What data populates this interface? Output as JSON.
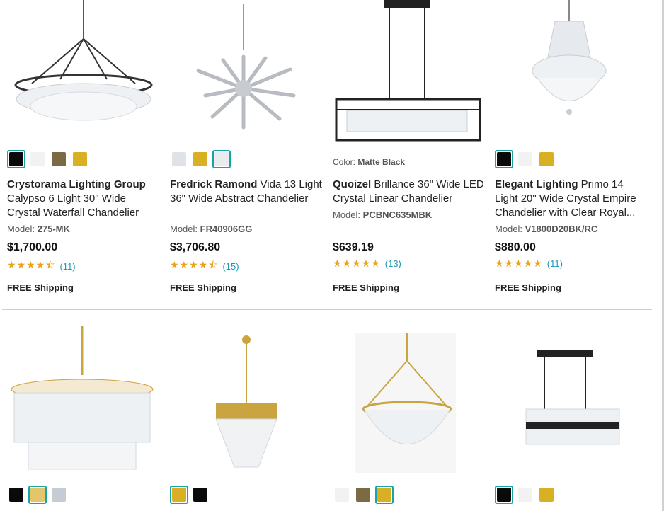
{
  "products_row1": [
    {
      "brand": "Crystorama Lighting Group",
      "name": " Calypso 6 Light 30\" Wide Crystal Waterfall Chandelier",
      "model_label": "Model:",
      "model": "275-MK",
      "price": "$1,700.00",
      "stars": "★★★★⯪",
      "reviews": "(11)",
      "shipping": "FREE Shipping",
      "swatches": [
        {
          "color": "#0a0a0a",
          "selected": true
        },
        {
          "color": "#f2f2f2",
          "selected": false
        },
        {
          "color": "#7b6a43",
          "selected": false
        },
        {
          "color": "#d9b024",
          "selected": false
        }
      ]
    },
    {
      "brand": "Fredrick Ramond",
      "name": " Vida 13 Light 36\" Wide Abstract Chandelier",
      "model_label": "Model:",
      "model": "FR40906GG",
      "price": "$3,706.80",
      "stars": "★★★★⯪",
      "reviews": "(15)",
      "shipping": "FREE Shipping",
      "swatches": [
        {
          "color": "#dfe3e8",
          "selected": false
        },
        {
          "color": "#d9b024",
          "selected": false
        },
        {
          "color": "#e9ecef",
          "selected": true
        }
      ]
    },
    {
      "brand": "Quoizel",
      "name": " Brillance 36\" Wide LED Crystal Linear Chandelier",
      "color_label": "Color:",
      "color_value": "Matte Black",
      "model_label": "Model:",
      "model": "PCBNC635MBK",
      "price": "$639.19",
      "stars": "★★★★★",
      "reviews": "(13)",
      "shipping": "FREE Shipping"
    },
    {
      "brand": "Elegant Lighting",
      "name": " Primo 14 Light 20\" Wide Crystal Empire Chandelier with Clear Royal...",
      "model_label": "Model:",
      "model": "V1800D20BK/RC",
      "price": "$880.00",
      "stars": "★★★★★",
      "reviews": "(11)",
      "shipping": "FREE Shipping",
      "swatches": [
        {
          "color": "#0a0a0a",
          "selected": true
        },
        {
          "color": "#f2f2f2",
          "selected": false
        },
        {
          "color": "#d9b024",
          "selected": false
        }
      ]
    }
  ],
  "products_row2_swatches": [
    [
      {
        "color": "#0a0a0a",
        "selected": false
      },
      {
        "color": "#e3c56a",
        "selected": true
      },
      {
        "color": "#c5ccd4",
        "selected": false
      }
    ],
    [
      {
        "color": "#d9b024",
        "selected": true
      },
      {
        "color": "#0a0a0a",
        "selected": false
      }
    ],
    [
      {
        "color": "#f2f2f2",
        "selected": false
      },
      {
        "color": "#7b6a43",
        "selected": false
      },
      {
        "color": "#d9b024",
        "selected": true
      }
    ],
    [
      {
        "color": "#0a0a0a",
        "selected": true
      },
      {
        "color": "#f2f2f2",
        "selected": false
      },
      {
        "color": "#d9b024",
        "selected": false
      }
    ]
  ],
  "colors": {
    "accent": "#1aa3a3",
    "star": "#e8a317",
    "review_link": "#1a9ab0"
  }
}
